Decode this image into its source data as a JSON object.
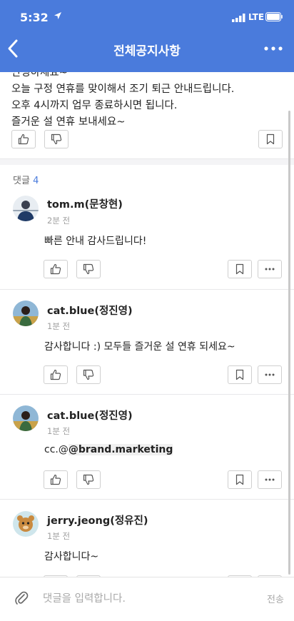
{
  "status_bar": {
    "time": "5:32",
    "network": "LTE"
  },
  "nav": {
    "title": "전체공지사항"
  },
  "post": {
    "lines": [
      "안녕하세요~",
      "오늘 구정 연휴를 맞이해서 조기 퇴근 안내드립니다.",
      "오후 4시까지 업무 종료하시면 됩니다.",
      "즐거운 설 연휴 보내세요~"
    ]
  },
  "comments_header": {
    "label": "댓글",
    "count": "4"
  },
  "comments": [
    {
      "author": "tom.m(문창현)",
      "ago": "2분 전",
      "text": "빠른 안내 감사드립니다!"
    },
    {
      "author": "cat.blue(정진영)",
      "ago": "1분 전",
      "text": "감사합니다 :) 모두들 즐거운 설 연휴 되세요~"
    },
    {
      "author": "cat.blue(정진영)",
      "ago": "1분 전",
      "text_prefix": "cc.@",
      "mention": "@brand.marketing"
    },
    {
      "author": "jerry.jeong(정유진)",
      "ago": "1분 전",
      "text": "감사합니다~"
    }
  ],
  "input": {
    "placeholder": "댓글을 입력합니다.",
    "send_label": "전송"
  },
  "colors": {
    "accent": "#4a7bdc",
    "muted": "#a0a0a0"
  }
}
